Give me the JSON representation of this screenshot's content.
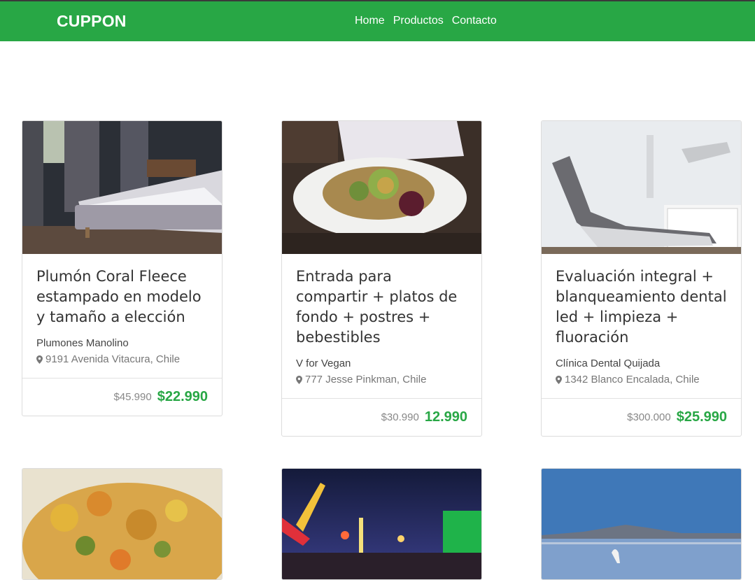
{
  "header": {
    "brand": "CUPPON",
    "nav": [
      "Home",
      "Productos",
      "Contacto"
    ]
  },
  "colors": {
    "accent": "#28a745",
    "price": "#28a745"
  },
  "cards": [
    {
      "title": "Plumón Coral Fleece estampado en modelo y tamaño a elección",
      "merchant": "Plumones Manolino",
      "address": "9191 Avenida Vitacura, Chile",
      "old_price": "$45.990",
      "new_price": "$22.990",
      "image": "bedroom-photo"
    },
    {
      "title": "Entrada para compartir + platos de fondo + postres + bebestibles",
      "merchant": "V for Vegan",
      "address": "777 Jesse Pinkman, Chile",
      "old_price": "$30.990",
      "new_price": "12.990",
      "image": "salad-plate-photo"
    },
    {
      "title": "Evaluación integral + blanqueamiento dental led + limpieza + fluoración",
      "merchant": "Clínica Dental Quijada",
      "address": "1342 Blanco Encalada, Chile",
      "old_price": "$300.000",
      "new_price": "$25.990",
      "image": "dental-chair-photo"
    },
    {
      "image": "food-dish-photo"
    },
    {
      "image": "carnival-night-photo"
    },
    {
      "image": "flamingo-lake-photo"
    }
  ]
}
